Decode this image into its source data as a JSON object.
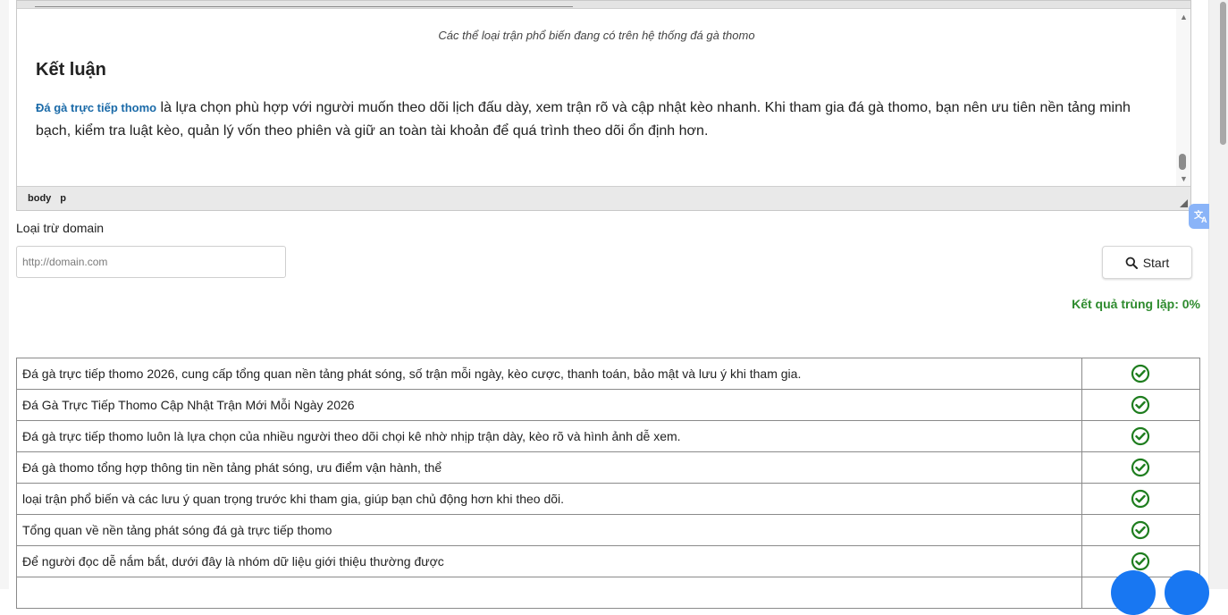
{
  "editor": {
    "caption": "Các thể loại trận phổ biến đang có trên hệ thống đá gà thomo",
    "heading": "Kết luận",
    "link_text": "Đá gà trực tiếp thomo",
    "paragraph": " là lựa chọn phù hợp với người muốn theo dõi lịch đấu dày, xem trận rõ và cập nhật kèo nhanh. Khi tham gia đá gà thomo, bạn nên ưu tiên nền tảng minh bạch, kiểm tra luật kèo, quản lý vốn theo phiên và giữ an toàn tài khoản để quá trình theo dõi ổn định hơn.",
    "path": [
      "body",
      "p"
    ]
  },
  "exclude": {
    "label": "Loại trừ domain",
    "placeholder": "http://domain.com"
  },
  "start_button": {
    "label": "Start",
    "icon": "search-icon"
  },
  "result": {
    "text": "Kết quả trùng lặp: 0%",
    "color": "#2e8b2e"
  },
  "rows": [
    {
      "text": "Đá gà trực tiếp thomo 2026, cung cấp tổng quan nền tảng phát sóng, số trận mỗi ngày, kèo cược, thanh toán, bảo mật và lưu ý khi tham gia.",
      "status": "check-circle-icon"
    },
    {
      "text": "Đá Gà Trực Tiếp Thomo Cập Nhật Trận Mới Mỗi Ngày 2026",
      "status": "check-circle-icon"
    },
    {
      "text": "Đá gà trực tiếp thomo luôn là lựa chọn của nhiều người theo dõi chọi kê nhờ nhịp trận dày, kèo rõ và hình ảnh dễ xem.",
      "status": "check-circle-icon"
    },
    {
      "text": "Đá gà thomo tổng hợp thông tin nền tảng phát sóng, ưu điểm vận hành, thể",
      "status": "check-circle-icon"
    },
    {
      "text": "loại trận phổ biến và các lưu ý quan trọng trước khi tham gia, giúp bạn chủ động hơn khi theo dõi.",
      "status": "check-circle-icon"
    },
    {
      "text": "Tổng quan về nền tảng phát sóng đá gà trực tiếp thomo",
      "status": "check-circle-icon"
    },
    {
      "text": "Để người đọc dễ nắm bắt, dưới đây là nhóm dữ liệu giới thiệu thường được",
      "status": "check-circle-icon"
    },
    {
      "text": "",
      "status": ""
    }
  ],
  "check_color": "#1e7d1e",
  "translate_icon": "translate-icon",
  "fab_color": "#1877f2"
}
